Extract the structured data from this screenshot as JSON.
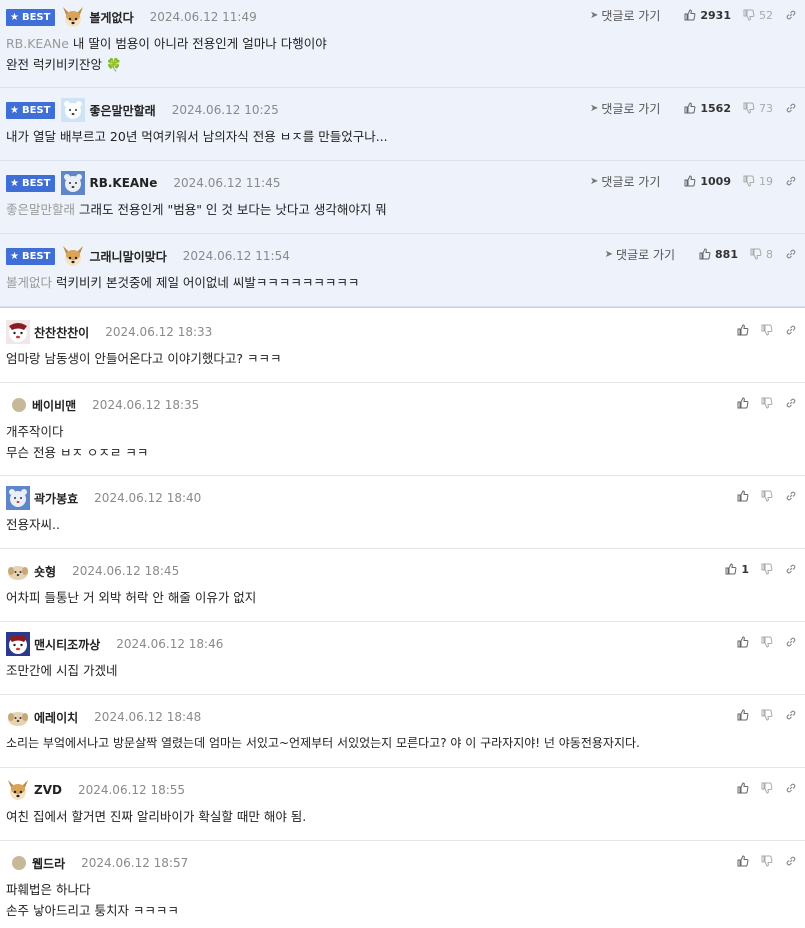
{
  "actions": {
    "goto_label": "댓글로 가기"
  },
  "best_label": "BEST",
  "best_comments": [
    {
      "nick": "볼게없다",
      "date": "2024.06.12 11:49",
      "mention": "RB.KEANe",
      "lines": [
        "내 딸이 범용이 아니라 전용인게 얼마나 다행이야",
        "완전 럭키비키잔앙"
      ],
      "emoji": "🍀",
      "up": "2931",
      "down": "52",
      "avatar": "dog"
    },
    {
      "nick": "좋은말만할래",
      "date": "2024.06.12 10:25",
      "mention": "",
      "lines": [
        "내가 열달 배부르고 20년 먹여키워서 남의자식 전용 ㅂㅈ를 만들었구나..."
      ],
      "emoji": "",
      "up": "1562",
      "down": "73",
      "avatar": "bear"
    },
    {
      "nick": "RB.KEANe",
      "date": "2024.06.12 11:45",
      "mention": "좋은말만할래",
      "lines": [
        "그래도 전용인게 \"범용\" 인 것 보다는 낫다고 생각해야지 뭐"
      ],
      "emoji": "",
      "up": "1009",
      "down": "19",
      "avatar": "bear2"
    },
    {
      "nick": "그래니말이맞다",
      "date": "2024.06.12 11:54",
      "mention": "볼게없다",
      "lines": [
        "럭키비키 본것중에 제일 어이없네 씨발ㅋㅋㅋㅋㅋㅋㅋㅋㅋ"
      ],
      "emoji": "",
      "up": "881",
      "down": "8",
      "avatar": "dog"
    }
  ],
  "comments": [
    {
      "nick": "찬찬찬찬이",
      "date": "2024.06.12 18:33",
      "lines": [
        "엄마랑 남동생이 안들어온다고 이야기했다고? ㅋㅋㅋ"
      ],
      "up": "",
      "avatar": "tiger"
    },
    {
      "nick": "베이비맨",
      "date": "2024.06.12 18:35",
      "lines": [
        "개주작이다",
        "무슨 전용 ㅂㅈ ㅇㅈㄹ ㅋㅋ"
      ],
      "up": "",
      "avatar": "dot"
    },
    {
      "nick": "곽가봉효",
      "date": "2024.06.12 18:40",
      "lines": [
        "전용자씨.."
      ],
      "up": "",
      "avatar": "bear2"
    },
    {
      "nick": "숏형",
      "date": "2024.06.12 18:45",
      "lines": [
        "어차피 들통난 거 외박 허락 안 해줄 이유가 없지"
      ],
      "up": "1",
      "avatar": "puppy"
    },
    {
      "nick": "맨시티조까상",
      "date": "2024.06.12 18:46",
      "lines": [
        "조만간에 시집 가겠네"
      ],
      "up": "",
      "avatar": "tiger"
    },
    {
      "nick": "에레이치",
      "date": "2024.06.12 18:48",
      "lines": [
        "소리는 부엌에서나고 방문살짝 열렸는데 엄마는 서있고~언제부터 서있었는지 모른다고? 야 이 구라자지야! 넌 야동전용자지다."
      ],
      "up": "",
      "avatar": "puppy"
    },
    {
      "nick": "ZVD",
      "date": "2024.06.12 18:55",
      "lines": [
        "여친 집에서 할거면 진짜 알리바이가 확실할 때만 해야 됨."
      ],
      "up": "",
      "avatar": "dog"
    },
    {
      "nick": "웹드라",
      "date": "2024.06.12 18:57",
      "lines": [
        "파훼법은 하나다",
        "손주 낳아드리고 퉁치자 ㅋㅋㅋㅋ"
      ],
      "up": "",
      "avatar": "dot"
    }
  ]
}
